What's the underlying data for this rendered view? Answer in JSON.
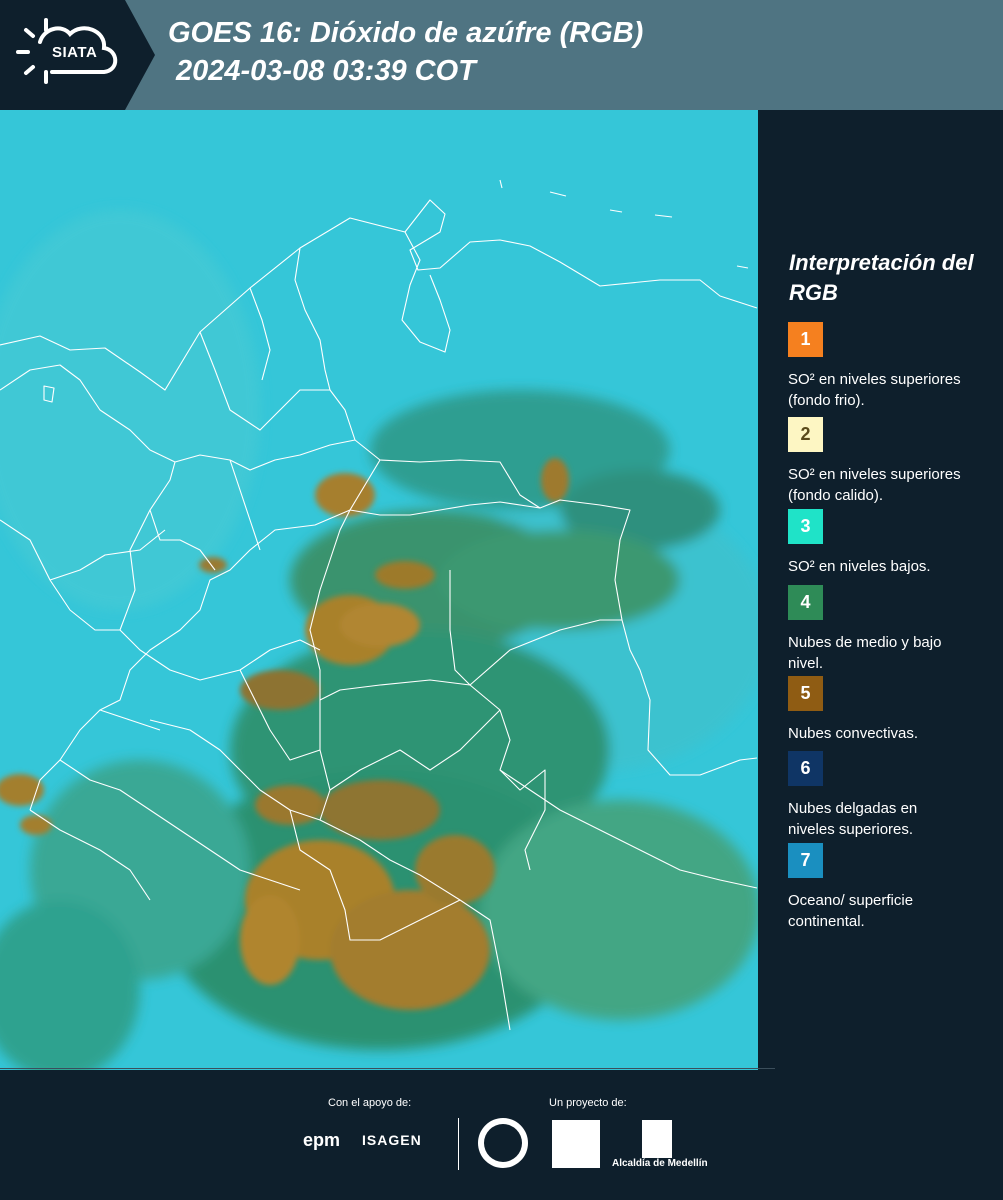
{
  "header": {
    "logo_text": "SIATA",
    "title_line1": "GOES 16: Dióxido de azúfre (RGB)",
    "title_line2": "2024-03-08 03:39 COT"
  },
  "legend": {
    "title": "Interpretación del RGB",
    "items": [
      {
        "number": "1",
        "color": "#f5801f",
        "description": "SO² en niveles superiores (fondo frio)."
      },
      {
        "number": "2",
        "color": "#fdf6c3",
        "description": "SO² en niveles superiores (fondo calido)."
      },
      {
        "number": "3",
        "color": "#1fe3c8",
        "description": "SO² en niveles bajos."
      },
      {
        "number": "4",
        "color": "#2e8b57",
        "description": "Nubes de medio y bajo nivel."
      },
      {
        "number": "5",
        "color": "#8f5c13",
        "description": "Nubes convectivas."
      },
      {
        "number": "6",
        "color": "#0f3565",
        "description": "Nubes delgadas en niveles superiores."
      },
      {
        "number": "7",
        "color": "#1a8fc0",
        "description": "Oceano/ superficie continental."
      }
    ]
  },
  "footer": {
    "support_label": "Con el apoyo de:",
    "project_label": "Un proyecto de:",
    "sponsors": [
      "epm",
      "ISAGEN"
    ],
    "partner_logo_text": "Alcaldía de Medellín"
  },
  "colors": {
    "ocean_cyan": "#35c6d8",
    "convective_brown": "#a9812c",
    "mid_cloud_green": "#3a8e63",
    "header_bg": "#4f7482",
    "panel_bg": "#0e1f2c"
  }
}
